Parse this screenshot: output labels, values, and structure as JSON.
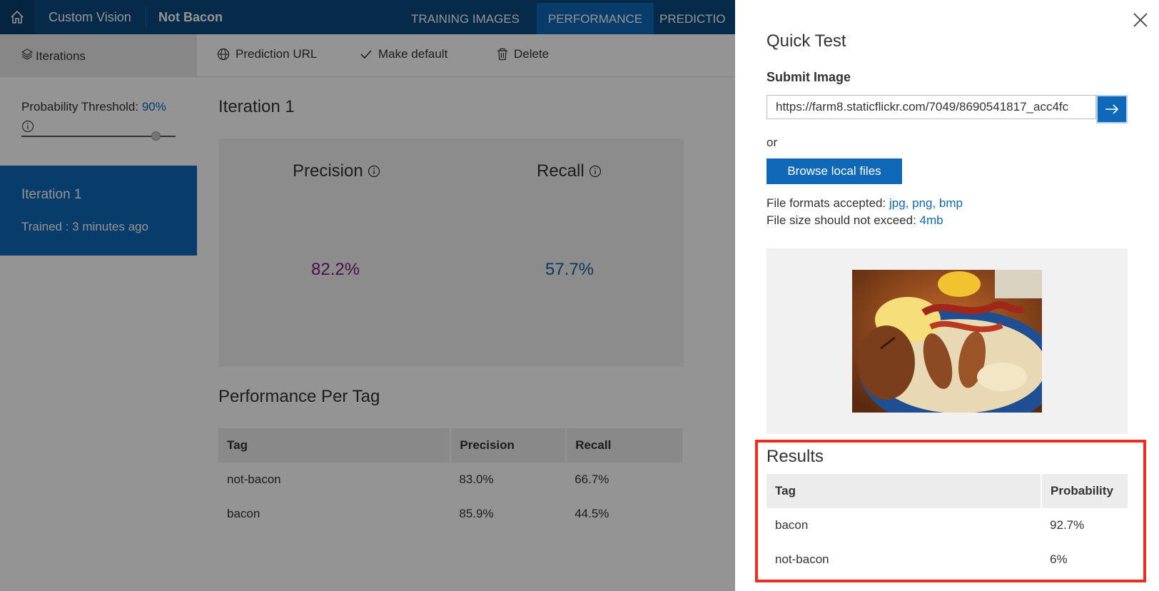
{
  "header": {
    "app_title": "Custom Vision",
    "project_title": "Not Bacon",
    "tabs": [
      {
        "label": "TRAINING IMAGES",
        "active": false
      },
      {
        "label": "PERFORMANCE",
        "active": true
      },
      {
        "label": "PREDICTIO",
        "active": false
      }
    ],
    "icons": {
      "home": "home-icon"
    }
  },
  "sidebar": {
    "iterations_label": "Iterations",
    "threshold_label": "Probability Threshold:",
    "threshold_value": "90%",
    "threshold_fraction": 0.9,
    "selected_iteration": {
      "title": "Iteration 1",
      "subtitle": "Trained : 3 minutes ago"
    }
  },
  "toolbar": {
    "prediction_url": "Prediction URL",
    "make_default": "Make default",
    "delete": "Delete"
  },
  "main": {
    "iteration_heading": "Iteration 1",
    "precision_label": "Precision",
    "recall_label": "Recall",
    "precision_value": "82.2%",
    "recall_value": "57.7%",
    "per_tag_heading": "Performance Per Tag",
    "table": {
      "headers": [
        "Tag",
        "Precision",
        "Recall"
      ],
      "rows": [
        [
          "not-bacon",
          "83.0%",
          "66.7%"
        ],
        [
          "bacon",
          "85.9%",
          "44.5%"
        ]
      ]
    }
  },
  "quick_test": {
    "title": "Quick Test",
    "submit_label": "Submit Image",
    "url_value": "https://farm8.staticflickr.com/7049/8690541817_acc4fc",
    "or_text": "or",
    "browse_label": "Browse local files",
    "formats_label": "File formats accepted:",
    "formats_value": "jpg, png, bmp",
    "size_label": "File size should not exceed:",
    "size_value": "4mb",
    "results_title": "Results",
    "results_table": {
      "headers": [
        "Tag",
        "Probability"
      ],
      "rows": [
        [
          "bacon",
          "92.7%"
        ],
        [
          "not-bacon",
          "6%"
        ]
      ]
    }
  },
  "colors": {
    "nav_bg": "#0b4a80",
    "accent": "#0f69b8",
    "precision": "#7a1f80",
    "recall": "#1a5fa0",
    "highlight": "#ef2b1f"
  }
}
